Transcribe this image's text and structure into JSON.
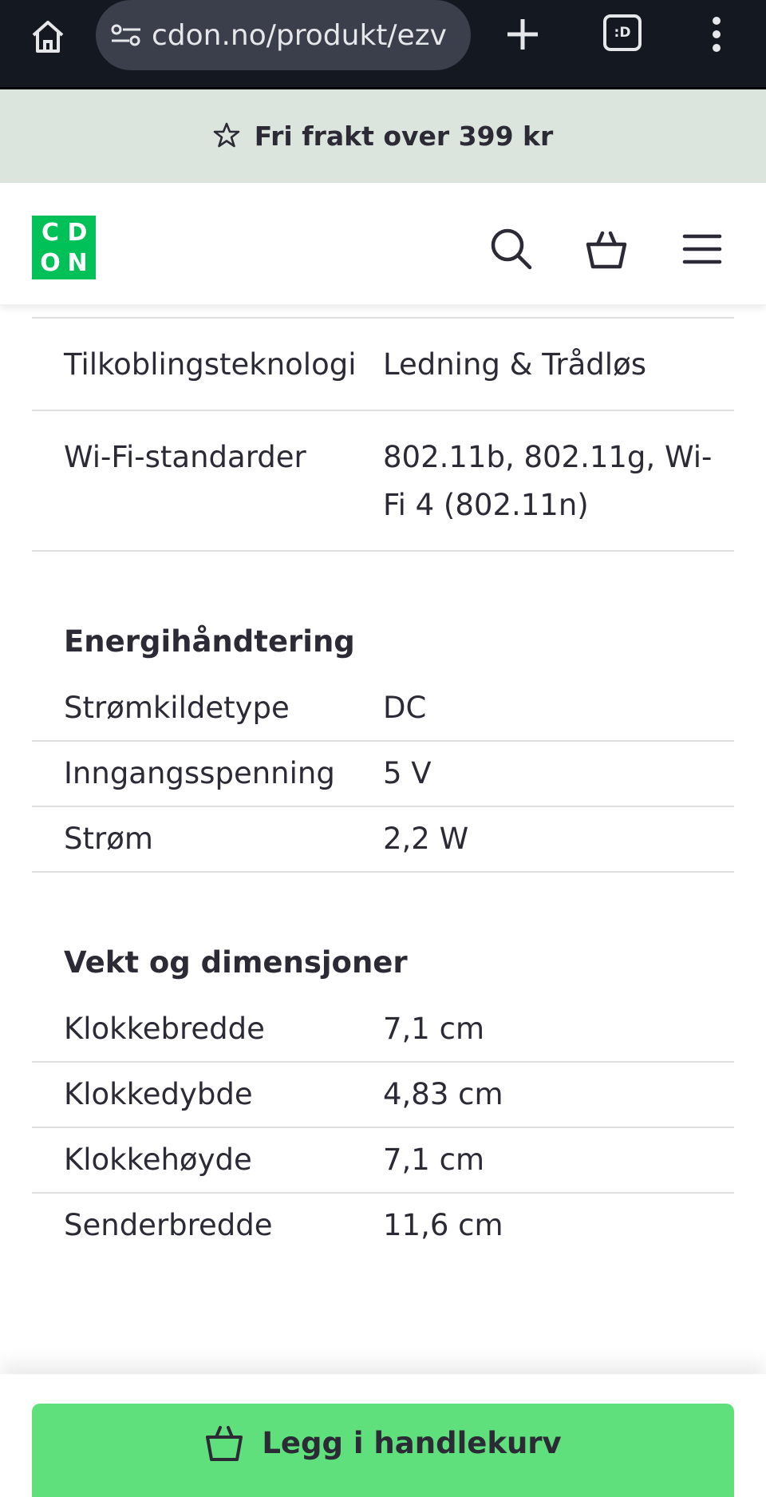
{
  "browser": {
    "url": "cdon.no/produkt/ezv",
    "tab_count": ":D"
  },
  "promo": {
    "text": "Fri frakt over 399 kr"
  },
  "logo": {
    "letters": [
      "C",
      "D",
      "O",
      "N"
    ]
  },
  "header": {
    "icons": [
      "search-icon",
      "basket-icon",
      "menu-icon"
    ]
  },
  "specs": {
    "connectivity": [
      {
        "key": "Tilkoblingsteknologi",
        "value": "Ledning & Trådløs"
      },
      {
        "key": "Wi-Fi-standarder",
        "value": "802.11b, 802.11g, Wi-Fi 4 (802.11n)"
      }
    ],
    "energy": {
      "title": "Energihåndtering",
      "rows": [
        {
          "key": "Strømkildetype",
          "value": "DC"
        },
        {
          "key": "Inngangsspenning",
          "value": "5 V"
        },
        {
          "key": "Strøm",
          "value": "2,2 W"
        }
      ]
    },
    "dimensions": {
      "title": "Vekt og dimensjoner",
      "rows": [
        {
          "key": "Klokkebredde",
          "value": "7,1 cm"
        },
        {
          "key": "Klokkedybde",
          "value": "4,83 cm"
        },
        {
          "key": "Klokkehøyde",
          "value": "7,1 cm"
        },
        {
          "key": "Senderbredde",
          "value": "11,6 cm"
        }
      ]
    }
  },
  "cta": {
    "label": "Legg i handlekurv"
  },
  "colors": {
    "brand_green": "#00c157",
    "cta_green": "#5fe07c",
    "promo_bg": "#dce4de",
    "text": "#2b2a35"
  }
}
